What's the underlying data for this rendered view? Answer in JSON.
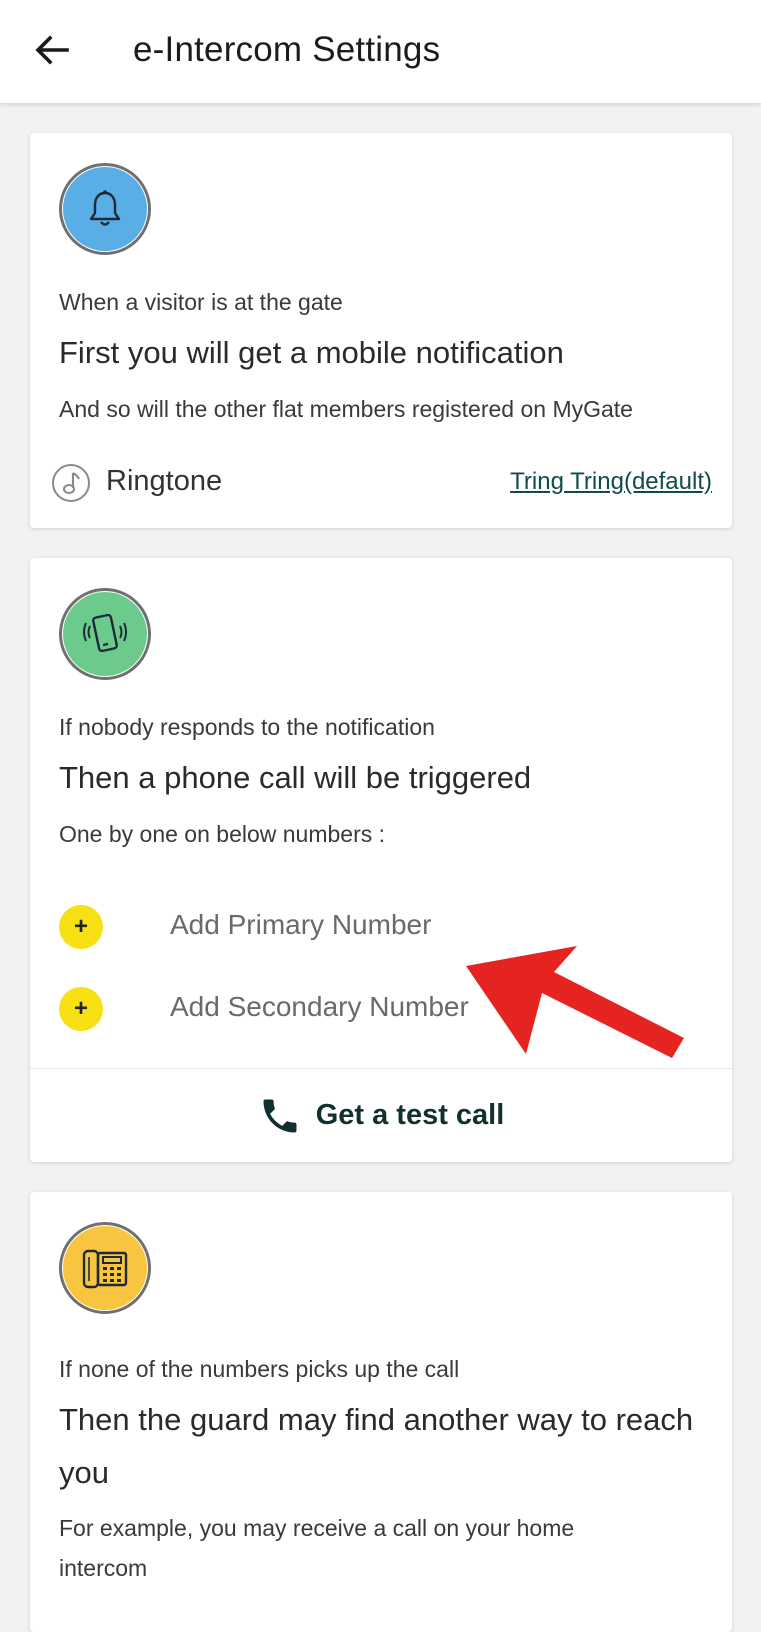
{
  "header": {
    "title": "e-Intercom Settings",
    "back_icon": "arrow-left-icon"
  },
  "cards": [
    {
      "icon": "bell-icon",
      "icon_color": "#5aaee6",
      "small": "When a visitor is at the gate",
      "big": "First you will get a mobile notification",
      "detail": "And so will the other flat members registered on MyGate",
      "ringtone": {
        "icon": "music-note-icon",
        "label": "Ringtone",
        "value": "Tring Tring(default)"
      }
    },
    {
      "icon": "vibrating-phone-icon",
      "icon_color": "#6ccb8c",
      "small": "If nobody responds to the notification",
      "big": "Then a phone call will be triggered",
      "detail": "One by one on below numbers :",
      "add_primary": {
        "symbol": "+",
        "label": "Add Primary Number"
      },
      "add_secondary": {
        "symbol": "+",
        "label": "Add Secondary Number"
      },
      "test_call": {
        "icon": "phone-icon",
        "label": "Get a test call"
      }
    },
    {
      "icon": "desk-phone-icon",
      "icon_color": "#f9c540",
      "small": "If none of the numbers picks up the call",
      "big_line1": "Then the guard may find another way to reach",
      "big_line2": "you",
      "detail_line1": "For example, you may receive a call on your home",
      "detail_line2": "intercom"
    }
  ],
  "annotation": {
    "icon": "red-arrow-icon",
    "color": "#e52421"
  }
}
